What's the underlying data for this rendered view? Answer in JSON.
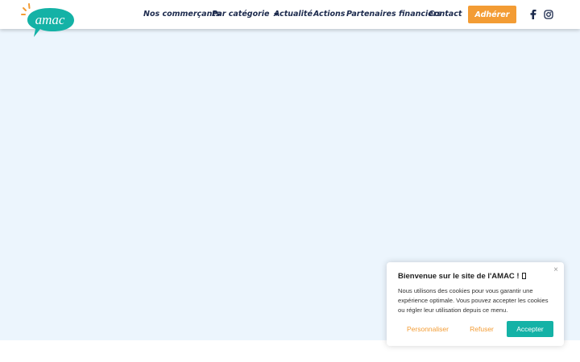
{
  "header": {
    "logo_text": "amac",
    "nav": [
      {
        "label": "Nos commerçants"
      },
      {
        "label": "Par catégorie",
        "has_dropdown": true
      },
      {
        "label": "Actualité"
      },
      {
        "label": "Actions"
      },
      {
        "label": "Partenaires financiers"
      },
      {
        "label": "Contact"
      }
    ],
    "cta_label": "Adhérer",
    "social_icons": [
      "facebook-icon",
      "instagram-icon"
    ]
  },
  "cookie_banner": {
    "title": "Bienvenue sur le site de l'AMAC !",
    "body": "Nous utilisons des cookies pour vous garantir une expérience optimale. Vous pouvez accepter les cookies ou régler leur utilisation depuis ce menu.",
    "buttons": {
      "customize": "Personnaliser",
      "refuse": "Refuser",
      "accept": "Accepter"
    },
    "close_glyph": "×"
  },
  "colors": {
    "brand_teal": "#14b2a6",
    "brand_orange": "#f39c34",
    "nav_text": "#1c2a4d",
    "hero_bg": "#ecf5fd"
  }
}
